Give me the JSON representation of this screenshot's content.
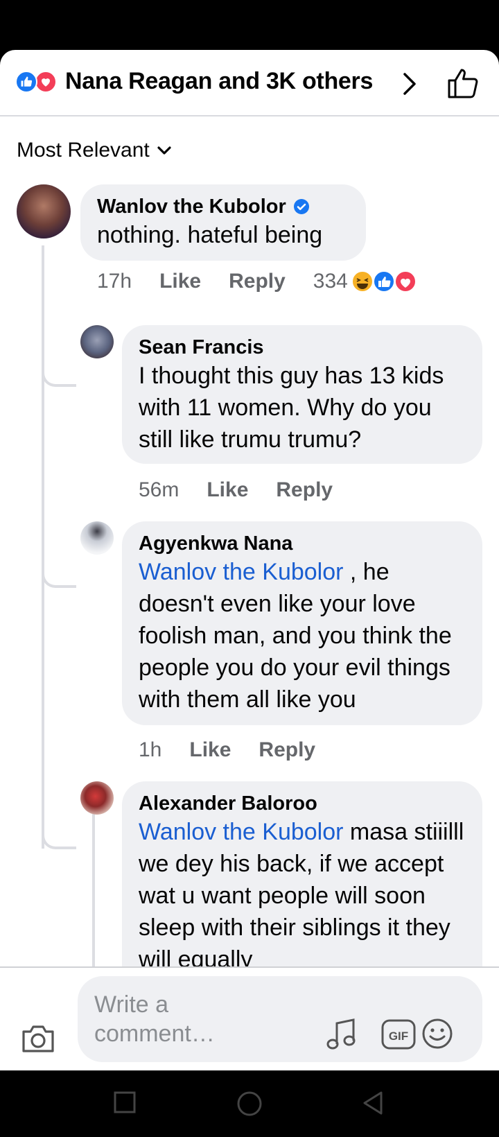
{
  "header": {
    "reactors_text": "Nana Reagan and 3K others"
  },
  "sort": {
    "label": "Most Relevant"
  },
  "comments": [
    {
      "author": "Wanlov the Kubolor",
      "verified": true,
      "text": "nothing. hateful being",
      "time": "17h",
      "like": "Like",
      "reply": "Reply",
      "reaction_count": "334"
    },
    {
      "author": "Sean Francis",
      "text": "I thought this guy has 13 kids with 11 women. Why do you still like trumu trumu?",
      "time": "56m",
      "like": "Like",
      "reply": "Reply"
    },
    {
      "author": "Agyenkwa Nana",
      "mention": "Wanlov the Kubolor",
      "text": " , he doesn't even like your love foolish man, and you think the people you do your evil things with them all like you",
      "time": "1h",
      "like": "Like",
      "reply": "Reply"
    },
    {
      "author": "Alexander Baloroo",
      "mention": "Wanlov the Kubolor",
      "text": " masa stiiilll we dey his back, if we accept wat u want people will soon sleep with their siblings it they will equally"
    }
  ],
  "composer": {
    "placeholder": "Write a comment…"
  },
  "colors": {
    "like_blue": "#1877f2",
    "love_red": "#f33e58",
    "haha_yellow": "#f7b125",
    "mention_blue": "#1a5ed1",
    "verified_blue": "#1877f2"
  },
  "icons": [
    "like-reaction-icon",
    "love-reaction-icon",
    "haha-reaction-icon",
    "chevron-right-icon",
    "thumbs-up-icon",
    "chevron-down-icon",
    "verified-icon",
    "camera-icon",
    "music-icon",
    "gif-icon",
    "emoji-icon",
    "recent-apps-icon",
    "home-icon",
    "back-icon"
  ]
}
